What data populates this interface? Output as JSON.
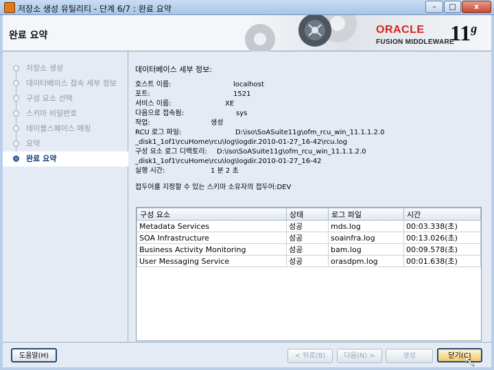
{
  "window": {
    "title": "저장소 생성 유틸리티 - 단계 6/7 : 완료 요약",
    "minimize": "–",
    "maximize": "□",
    "close": "x"
  },
  "header": {
    "page_title": "완료 요약",
    "brand_top": "ORACLE",
    "brand_bottom": "FUSION MIDDLEWARE",
    "version": "11",
    "version_sup": "g"
  },
  "steps": [
    {
      "label": "저장소 생성",
      "state": "done"
    },
    {
      "label": "데이터베이스 접속 세부 정보",
      "state": "done"
    },
    {
      "label": "구성 요소 선택",
      "state": "done"
    },
    {
      "label": "스키마 비밀번호",
      "state": "done"
    },
    {
      "label": "테이블스페이스 매핑",
      "state": "done"
    },
    {
      "label": "요약",
      "state": "done"
    },
    {
      "label": "완료 요약",
      "state": "active"
    }
  ],
  "summary": {
    "section_title": "데이터베이스 세부 정보:",
    "host_label": "호스트 이름:",
    "host_value": "localhost",
    "port_label": "포트:",
    "port_value": "1521",
    "service_label": "서비스 이름:",
    "service_value": "XE",
    "user_label": "다음으로 접속됨:",
    "user_value": "sys",
    "op_label": "작업:",
    "op_value": "생성",
    "rcu_log_label": "RCU 로그 파일:",
    "rcu_log_value": "D:\\iso\\SoASuite11g\\ofm_rcu_win_11.1.1.2.0",
    "rcu_log_cont": "_disk1_1of1\\rcuHome\\rcu\\log\\logdir.2010-01-27_16-42\\rcu.log",
    "comp_log_label": "구성 요소 로그 디렉토리:",
    "comp_log_value": "D:\\iso\\SoASuite11g\\ofm_rcu_win_11.1.1.2.0",
    "comp_log_cont": "_disk1_1of1\\rcuHome\\rcu\\log\\logdir.2010-01-27_16-42",
    "time_label": "실행 시간:",
    "time_value": "1 분 2 초",
    "prefix_text": "접두어를 지정할 수 있는 스키마 소유자의 접두어:DEV"
  },
  "table": {
    "headers": [
      "구성 요소",
      "상태",
      "로그 파일",
      "시간"
    ],
    "rows": [
      [
        "Metadata Services",
        "성공",
        "mds.log",
        "00:03.338(초)"
      ],
      [
        "SOA Infrastructure",
        "성공",
        "soainfra.log",
        "00:13.026(초)"
      ],
      [
        "Business Activity Monitoring",
        "성공",
        "bam.log",
        "00:09.578(초)"
      ],
      [
        "User Messaging Service",
        "성공",
        "orasdpm.log",
        "00:01.638(초)"
      ]
    ]
  },
  "footer": {
    "help": "도움말(H)",
    "back": "< 뒤로(B)",
    "next": "다음(N) >",
    "create": "생성",
    "close": "닫기(C)"
  }
}
